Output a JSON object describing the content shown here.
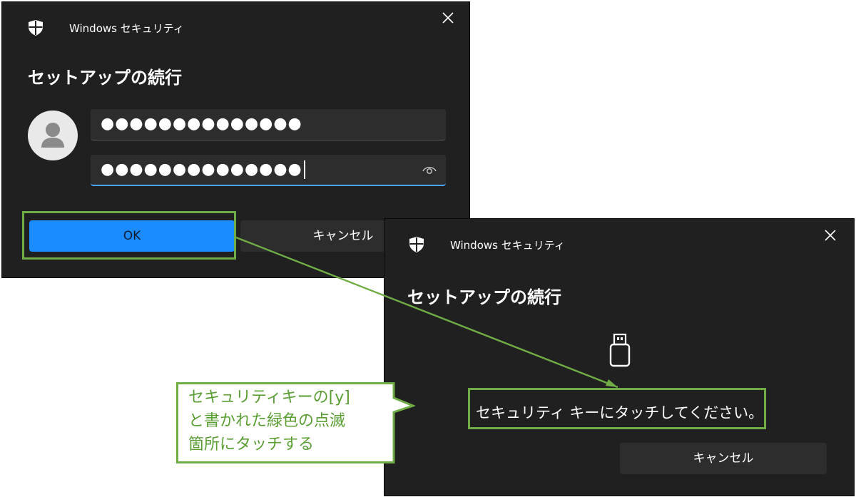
{
  "dialog1": {
    "app_title": "Windows セキュリティ",
    "heading": "セットアップの続行",
    "username_value": "●●●●●●●●●●●●●●",
    "password_value": "●●●●●●●●●●●●●●",
    "ok_label": "OK",
    "cancel_label": "キャンセル"
  },
  "dialog2": {
    "app_title": "Windows セキュリティ",
    "heading": "セットアップの続行",
    "message": "セキュリティ キーにタッチしてください。",
    "cancel_label": "キャンセル"
  },
  "callout": {
    "lines": [
      "セキュリティキーの[y]",
      "と書かれた緑色の点滅",
      "箇所にタッチする"
    ]
  },
  "colors": {
    "dialog_bg": "#202020",
    "primary_button": "#1a8cff",
    "focus_underline": "#4aa7ff",
    "annotation_green": "#70ad47"
  }
}
